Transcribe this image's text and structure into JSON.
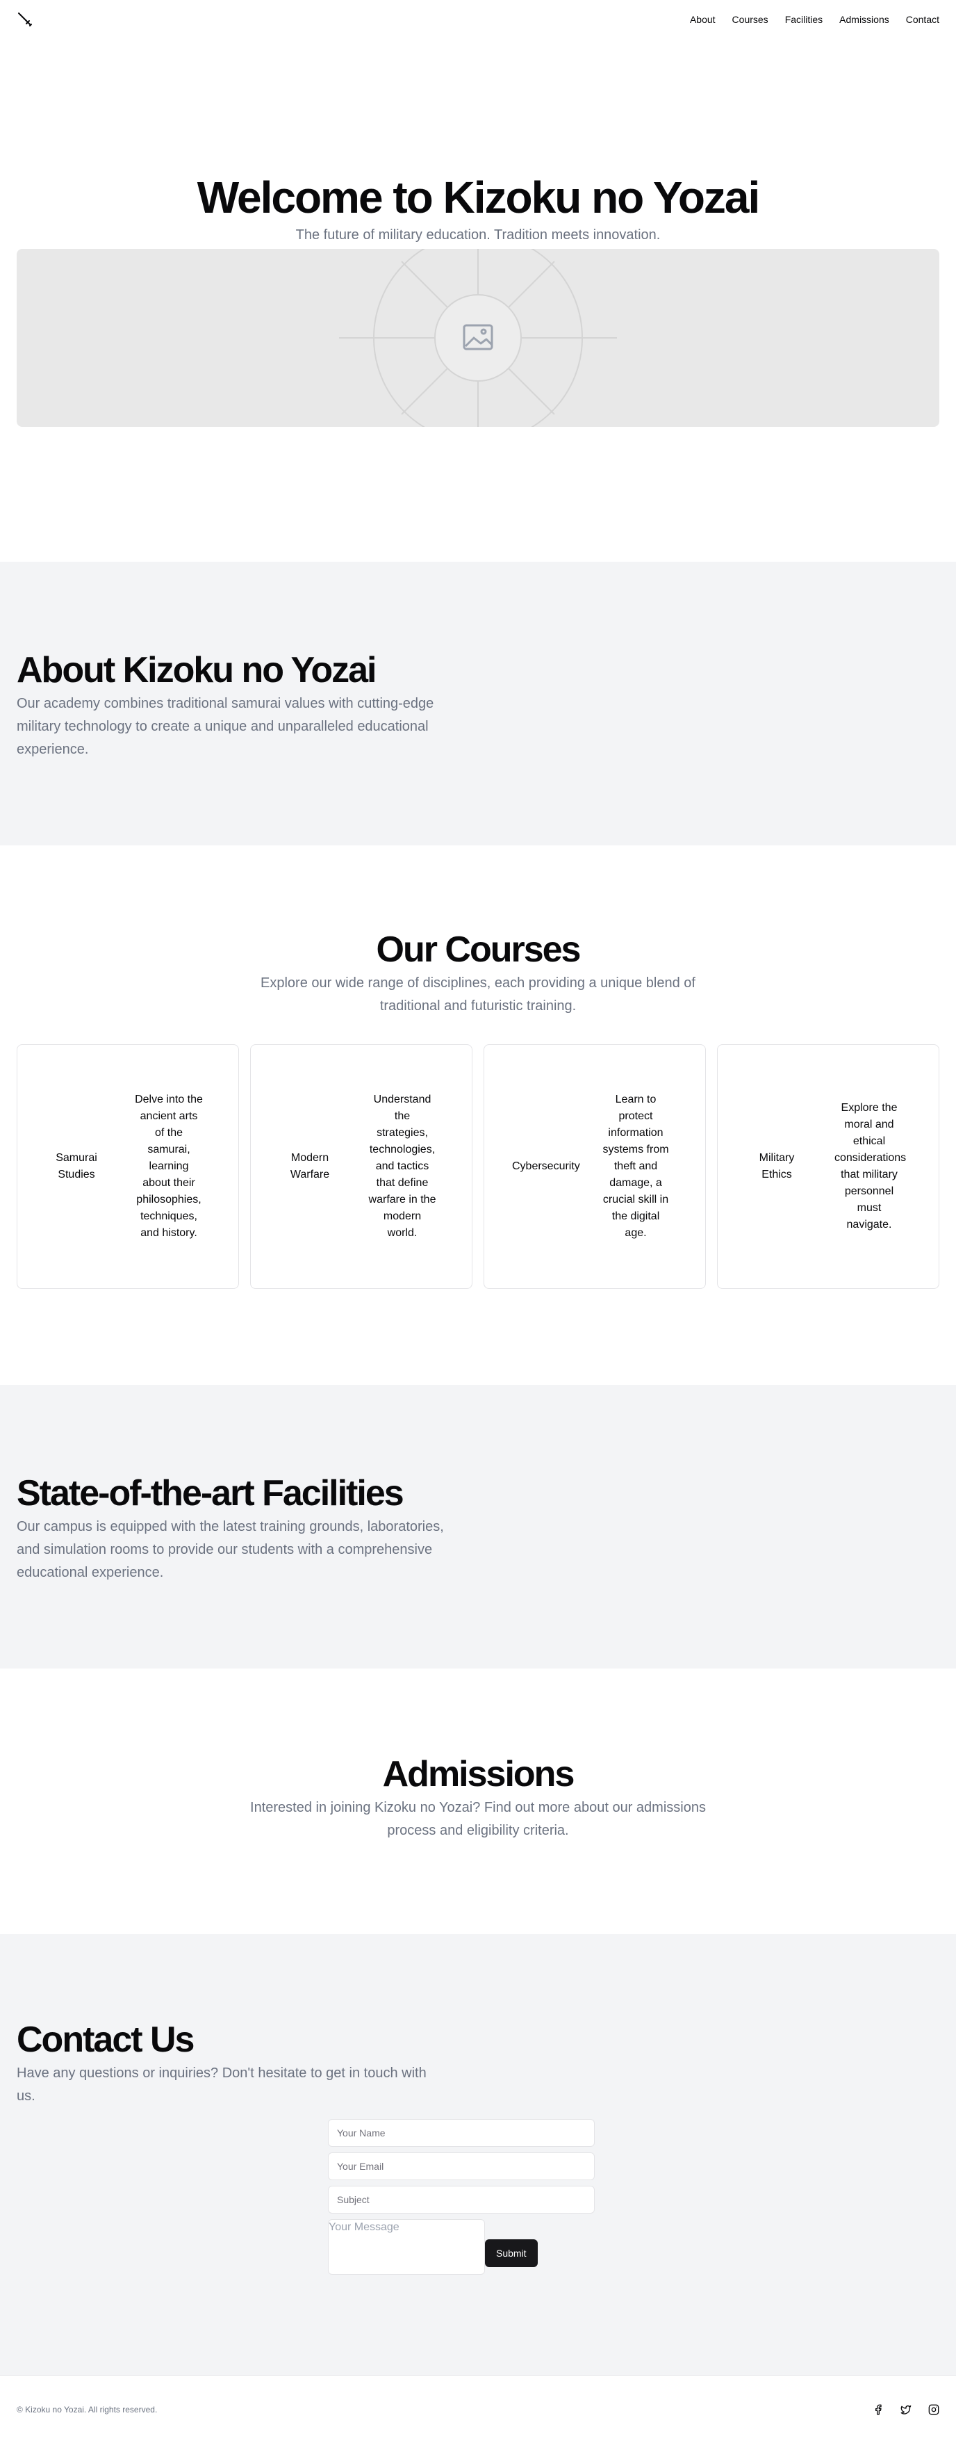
{
  "nav": {
    "items": [
      {
        "label": "About"
      },
      {
        "label": "Courses"
      },
      {
        "label": "Facilities"
      },
      {
        "label": "Admissions"
      },
      {
        "label": "Contact"
      }
    ]
  },
  "hero": {
    "title": "Welcome to Kizoku no Yozai",
    "subtitle": "The future of military education. Tradition meets innovation.",
    "image_icon": "image-placeholder-icon"
  },
  "about": {
    "title": "About Kizoku no Yozai",
    "text": "Our academy combines traditional samurai values with cutting-edge military technology to create a unique and unparalleled educational experience."
  },
  "courses": {
    "title": "Our Courses",
    "text": "Explore our wide range of disciplines, each providing a unique blend of traditional and futuristic training.",
    "items": [
      {
        "name": "Samurai Studies",
        "desc": "Delve into the ancient arts of the samurai, learning about their philosophies, techniques, and history."
      },
      {
        "name": "Modern Warfare",
        "desc": "Understand the strategies, technologies, and tactics that define warfare in the modern world."
      },
      {
        "name": "Cybersecurity",
        "desc": "Learn to protect information systems from theft and damage, a crucial skill in the digital age."
      },
      {
        "name": "Military Ethics",
        "desc": "Explore the moral and ethical considerations that military personnel must navigate."
      }
    ]
  },
  "facilities": {
    "title": "State-of-the-art Facilities",
    "text": "Our campus is equipped with the latest training grounds, laboratories, and simulation rooms to provide our students with a comprehensive educational experience."
  },
  "admissions": {
    "title": "Admissions",
    "text": "Interested in joining Kizoku no Yozai? Find out more about our admissions process and eligibility criteria."
  },
  "contact": {
    "title": "Contact Us",
    "text": "Have any questions or inquiries? Don't hesitate to get in touch with us.",
    "name_placeholder": "Your Name",
    "email_placeholder": "Your Email",
    "subject_placeholder": "Subject",
    "message_placeholder": "Your Message",
    "submit_label": "Submit"
  },
  "footer": {
    "copyright": "© Kizoku no Yozai. All rights reserved.",
    "social": [
      "facebook-icon",
      "twitter-icon",
      "instagram-icon"
    ]
  }
}
